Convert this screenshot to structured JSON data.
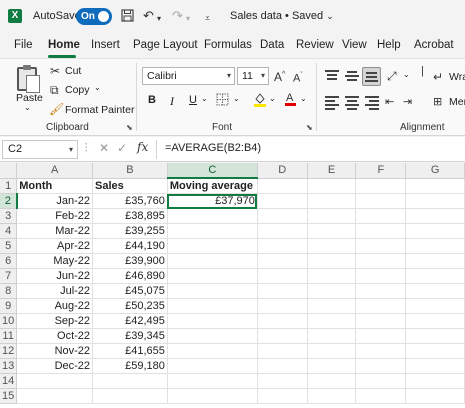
{
  "titlebar": {
    "logo": "X",
    "autosave_label": "AutoSave",
    "autosave_state": "On",
    "doc_title": "Sales data • Saved",
    "icons": [
      "save-icon",
      "undo-icon",
      "redo-icon",
      "customize-icon",
      "chevron-down-icon"
    ]
  },
  "tabs": [
    "File",
    "Home",
    "Insert",
    "Page Layout",
    "Formulas",
    "Data",
    "Review",
    "View",
    "Help",
    "Acrobat"
  ],
  "active_tab": "Home",
  "ribbon": {
    "clipboard": {
      "paste": "Paste",
      "cut": "Cut",
      "copy": "Copy",
      "format_painter": "Format Painter",
      "label": "Clipboard"
    },
    "font": {
      "font_name": "Calibri",
      "font_size": "11",
      "bold": "B",
      "italic": "I",
      "underline": "U",
      "label": "Font"
    },
    "alignment": {
      "wrap": "Wra",
      "merge": "Mer",
      "label": "Alignment"
    },
    "accent": "#107c41"
  },
  "formula_bar": {
    "cell_ref": "C2",
    "fx": "fx",
    "formula": "=AVERAGE(B2:B4)"
  },
  "sheet": {
    "columns": [
      "A",
      "B",
      "C",
      "D",
      "E",
      "F",
      "G"
    ],
    "rows": [
      [
        "Month",
        "Sales",
        "Moving average",
        "",
        "",
        "",
        ""
      ],
      [
        "Jan-22",
        "£35,760",
        "£37,970",
        "",
        "",
        "",
        ""
      ],
      [
        "Feb-22",
        "£38,895",
        "",
        "",
        "",
        "",
        ""
      ],
      [
        "Mar-22",
        "£39,255",
        "",
        "",
        "",
        "",
        ""
      ],
      [
        "Apr-22",
        "£44,190",
        "",
        "",
        "",
        "",
        ""
      ],
      [
        "May-22",
        "£39,900",
        "",
        "",
        "",
        "",
        ""
      ],
      [
        "Jun-22",
        "£46,890",
        "",
        "",
        "",
        "",
        ""
      ],
      [
        "Jul-22",
        "£45,075",
        "",
        "",
        "",
        "",
        ""
      ],
      [
        "Aug-22",
        "£50,235",
        "",
        "",
        "",
        "",
        ""
      ],
      [
        "Sep-22",
        "£42,495",
        "",
        "",
        "",
        "",
        ""
      ],
      [
        "Oct-22",
        "£39,345",
        "",
        "",
        "",
        "",
        ""
      ],
      [
        "Nov-22",
        "£41,655",
        "",
        "",
        "",
        "",
        ""
      ],
      [
        "Dec-22",
        "£59,180",
        "",
        "",
        "",
        "",
        ""
      ],
      [
        "",
        "",
        "",
        "",
        "",
        "",
        ""
      ],
      [
        "",
        "",
        "",
        "",
        "",
        "",
        ""
      ]
    ],
    "active_cell": "C2"
  }
}
